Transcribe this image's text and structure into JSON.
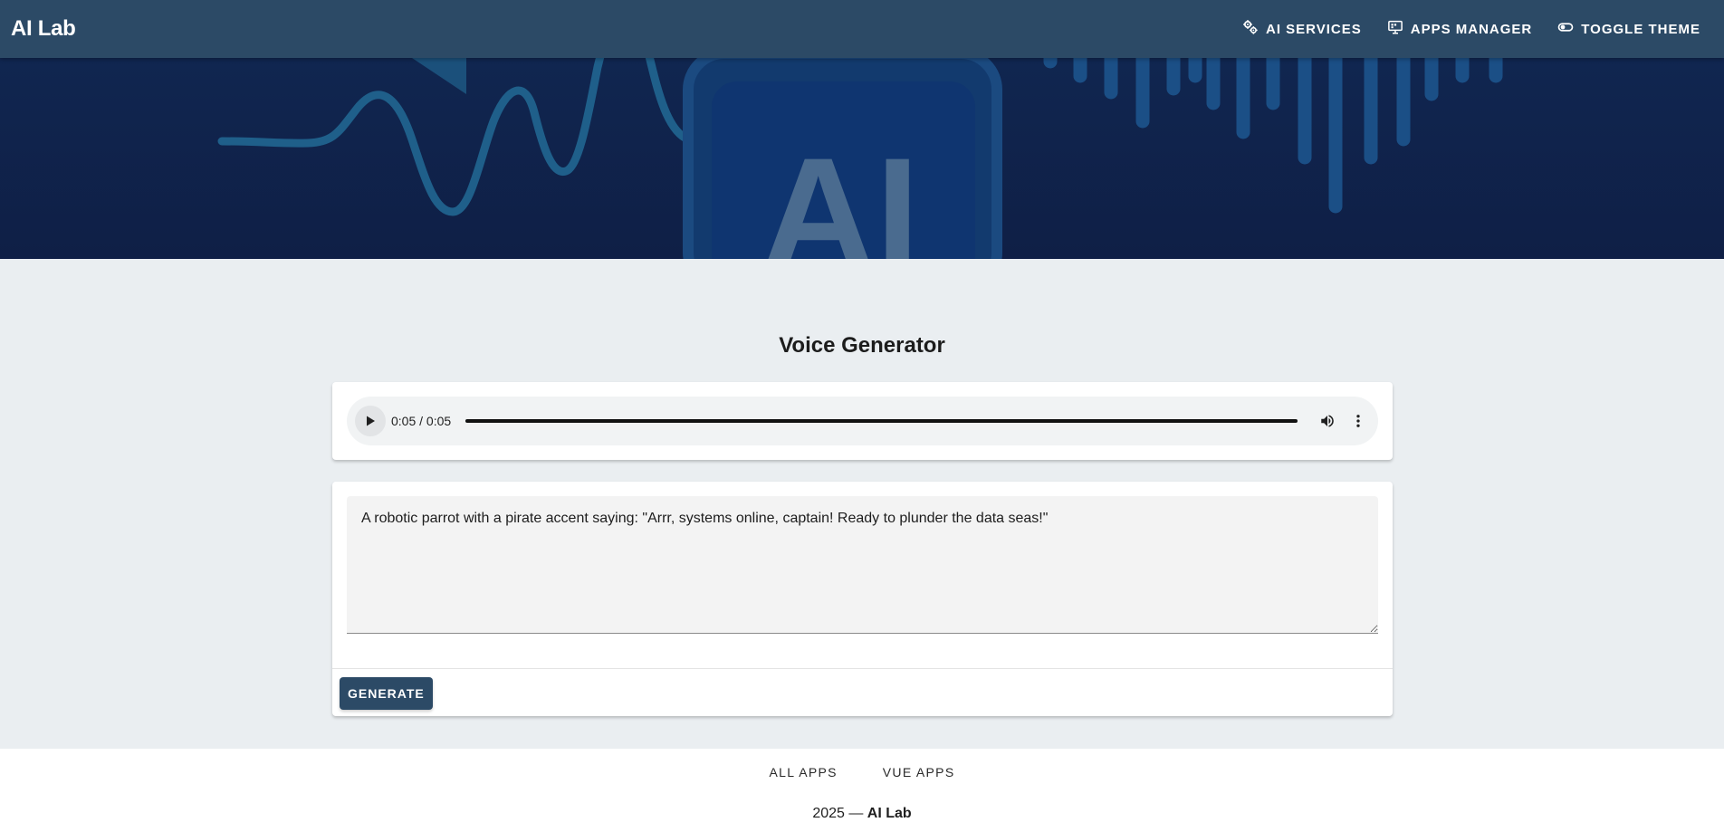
{
  "appbar": {
    "brand": "AI Lab",
    "nav": [
      {
        "label": "AI Services",
        "icon": "cogs-icon"
      },
      {
        "label": "Apps Manager",
        "icon": "monitor-apps-icon"
      },
      {
        "label": "Toggle Theme",
        "icon": "toggle-icon"
      }
    ]
  },
  "hero": {
    "logo_text": "AI"
  },
  "main": {
    "title": "Voice Generator",
    "audio": {
      "time": "0:05 / 0:05",
      "progress": 1.0
    },
    "prompt_value": "A robotic parrot with a pirate accent saying: \"Arrr, systems online, captain! Ready to plunder the data seas!\"",
    "generate_label": "Generate"
  },
  "footer": {
    "links": [
      "All Apps",
      "Vue Apps"
    ],
    "copyright_prefix": "2025 — ",
    "copyright_brand": "AI Lab"
  },
  "colors": {
    "appbar": "#2c4a66",
    "hero_bg": "#102650",
    "hero_accent": "#1f5f8a",
    "page_bg": "#eaeef1",
    "button": "#2c4a66"
  }
}
